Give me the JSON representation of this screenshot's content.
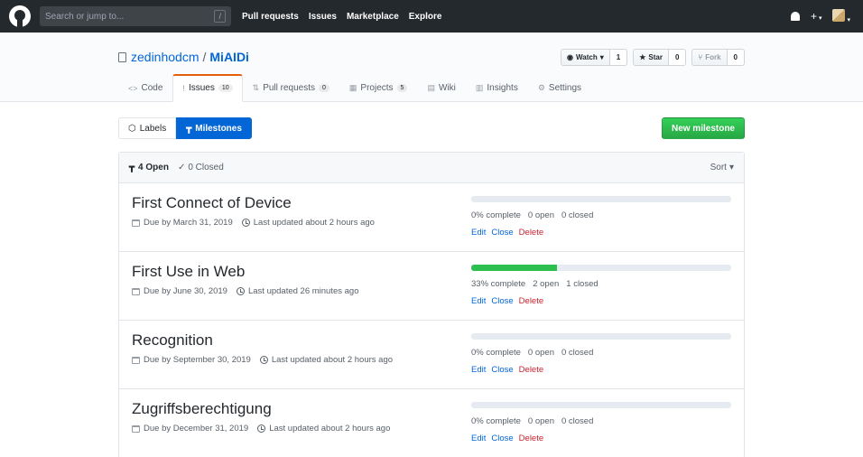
{
  "header": {
    "search_placeholder": "Search or jump to...",
    "slash": "/",
    "nav": [
      "Pull requests",
      "Issues",
      "Marketplace",
      "Explore"
    ],
    "plus": "+"
  },
  "repo": {
    "owner": "zedinhodcm",
    "separator": "/",
    "name": "MiAIDi",
    "watch_label": "Watch",
    "watch_count": "1",
    "star_label": "Star",
    "star_count": "0",
    "fork_label": "Fork",
    "fork_count": "0"
  },
  "reponav": [
    {
      "label": "Code",
      "icon": "<>"
    },
    {
      "label": "Issues",
      "counter": "10",
      "icon": "!"
    },
    {
      "label": "Pull requests",
      "counter": "0",
      "icon": "⇅"
    },
    {
      "label": "Projects",
      "counter": "5",
      "icon": "▦"
    },
    {
      "label": "Wiki",
      "icon": "▤"
    },
    {
      "label": "Insights",
      "icon": "▥"
    },
    {
      "label": "Settings",
      "icon": "⚙"
    }
  ],
  "subnav": {
    "labels": "Labels",
    "milestones": "Milestones",
    "new_milestone": "New milestone"
  },
  "box_header": {
    "open": "4 Open",
    "closed": "0 Closed",
    "sort": "Sort"
  },
  "milestones": [
    {
      "title": "First Connect of Device",
      "due": "Due by March 31, 2019",
      "updated": "Last updated about 2 hours ago",
      "percent": 0,
      "complete": "0% complete",
      "open": "0 open",
      "closed": "0 closed"
    },
    {
      "title": "First Use in Web",
      "due": "Due by June 30, 2019",
      "updated": "Last updated 26 minutes ago",
      "percent": 33,
      "complete": "33% complete",
      "open": "2 open",
      "closed": "1 closed"
    },
    {
      "title": "Recognition",
      "due": "Due by September 30, 2019",
      "updated": "Last updated about 2 hours ago",
      "percent": 0,
      "complete": "0% complete",
      "open": "0 open",
      "closed": "0 closed"
    },
    {
      "title": "Zugriffsberechtigung",
      "due": "Due by December 31, 2019",
      "updated": "Last updated about 2 hours ago",
      "percent": 0,
      "complete": "0% complete",
      "open": "0 open",
      "closed": "0 closed"
    }
  ],
  "actions": {
    "edit": "Edit",
    "close": "Close",
    "delete": "Delete"
  }
}
